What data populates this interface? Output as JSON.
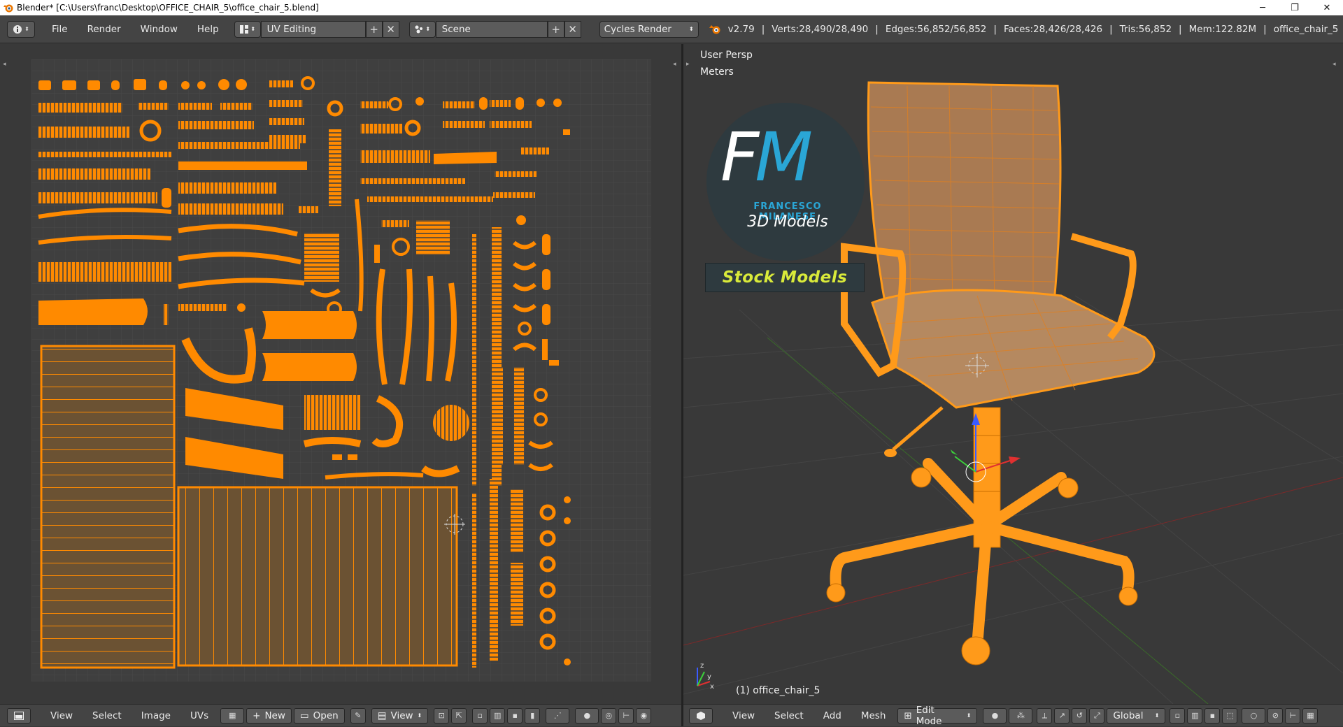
{
  "window": {
    "title": "Blender* [C:\\Users\\franc\\Desktop\\OFFICE_CHAIR_5\\office_chair_5.blend]",
    "minimize": "─",
    "maximize": "❐",
    "close": "✕"
  },
  "info_header": {
    "menus": [
      "File",
      "Render",
      "Window",
      "Help"
    ],
    "screen_layout": "UV Editing",
    "scene": "Scene",
    "render_engine": "Cycles Render",
    "stats": {
      "version": "v2.79",
      "verts": "Verts:28,490/28,490",
      "edges": "Edges:56,852/56,852",
      "faces": "Faces:28,426/28,426",
      "tris": "Tris:56,852",
      "mem": "Mem:122.82M",
      "object": "office_chair_5"
    }
  },
  "uv_editor": {
    "menus": [
      "View",
      "Select",
      "Image",
      "UVs"
    ],
    "new_label": "New",
    "open_label": "Open",
    "view_label": "View"
  },
  "viewport": {
    "view_name": "User Persp",
    "units": "Meters",
    "object_label": "(1) office_chair_5",
    "menus": [
      "View",
      "Select",
      "Add",
      "Mesh"
    ],
    "mode": "Edit Mode",
    "orientation": "Global"
  },
  "logo": {
    "letter_f": "F",
    "letter_m": "M",
    "name": "FRANCESCO MILANESE",
    "subtitle": "3D Models",
    "banner": "Stock Models"
  },
  "colors": {
    "uv_orange": "#ff8a00",
    "background": "#393939",
    "header": "#444444",
    "logo_blue": "#2aa6d6",
    "stock_yellow": "#d9ea3a"
  }
}
